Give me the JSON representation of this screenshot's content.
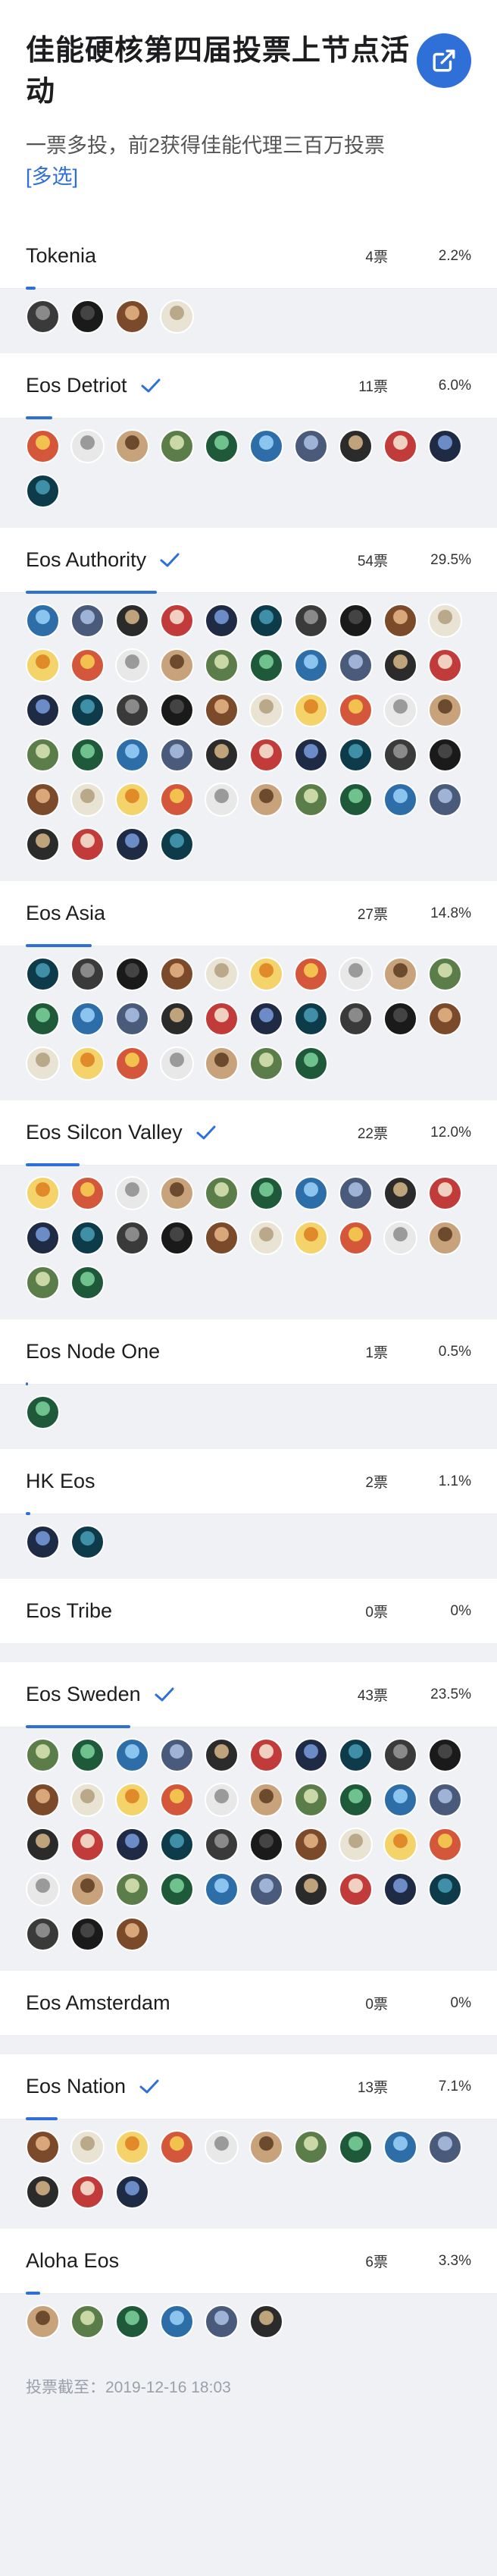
{
  "header": {
    "title": "佳能硬核第四届投票上节点活动",
    "subtitle": "一票多投，前2获得佳能代理三百万投票",
    "multi_tag": "[多选]"
  },
  "candidates": [
    {
      "name": "Tokenia",
      "votes": "4票",
      "pct": "2.2%",
      "share": 0.022,
      "checked": false,
      "avatars": 4
    },
    {
      "name": "Eos Detriot",
      "votes": "11票",
      "pct": "6.0%",
      "share": 0.06,
      "checked": true,
      "avatars": 11
    },
    {
      "name": "Eos Authority",
      "votes": "54票",
      "pct": "29.5%",
      "share": 0.295,
      "checked": true,
      "avatars": 54
    },
    {
      "name": "Eos Asia",
      "votes": "27票",
      "pct": "14.8%",
      "share": 0.148,
      "checked": false,
      "avatars": 27
    },
    {
      "name": "Eos Silcon Valley",
      "votes": "22票",
      "pct": "12.0%",
      "share": 0.12,
      "checked": true,
      "avatars": 22
    },
    {
      "name": "Eos Node One",
      "votes": "1票",
      "pct": "0.5%",
      "share": 0.005,
      "checked": false,
      "avatars": 1
    },
    {
      "name": "HK Eos",
      "votes": "2票",
      "pct": "1.1%",
      "share": 0.011,
      "checked": false,
      "avatars": 2
    },
    {
      "name": "Eos Tribe",
      "votes": "0票",
      "pct": "0%",
      "share": 0,
      "checked": false,
      "avatars": 0
    },
    {
      "name": "Eos Sweden",
      "votes": "43票",
      "pct": "23.5%",
      "share": 0.235,
      "checked": true,
      "avatars": 43
    },
    {
      "name": "Eos Amsterdam",
      "votes": "0票",
      "pct": "0%",
      "share": 0,
      "checked": false,
      "avatars": 0
    },
    {
      "name": "Eos Nation",
      "votes": "13票",
      "pct": "7.1%",
      "share": 0.071,
      "checked": true,
      "avatars": 13
    },
    {
      "name": "Aloha Eos",
      "votes": "6票",
      "pct": "3.3%",
      "share": 0.033,
      "checked": false,
      "avatars": 6
    }
  ],
  "footer": {
    "deadline": "投票截至：2019-12-16 18:03"
  },
  "colors": {
    "accent": "#2f6fd8"
  },
  "icons": {
    "share": "external-link-icon",
    "check": "check-icon"
  }
}
